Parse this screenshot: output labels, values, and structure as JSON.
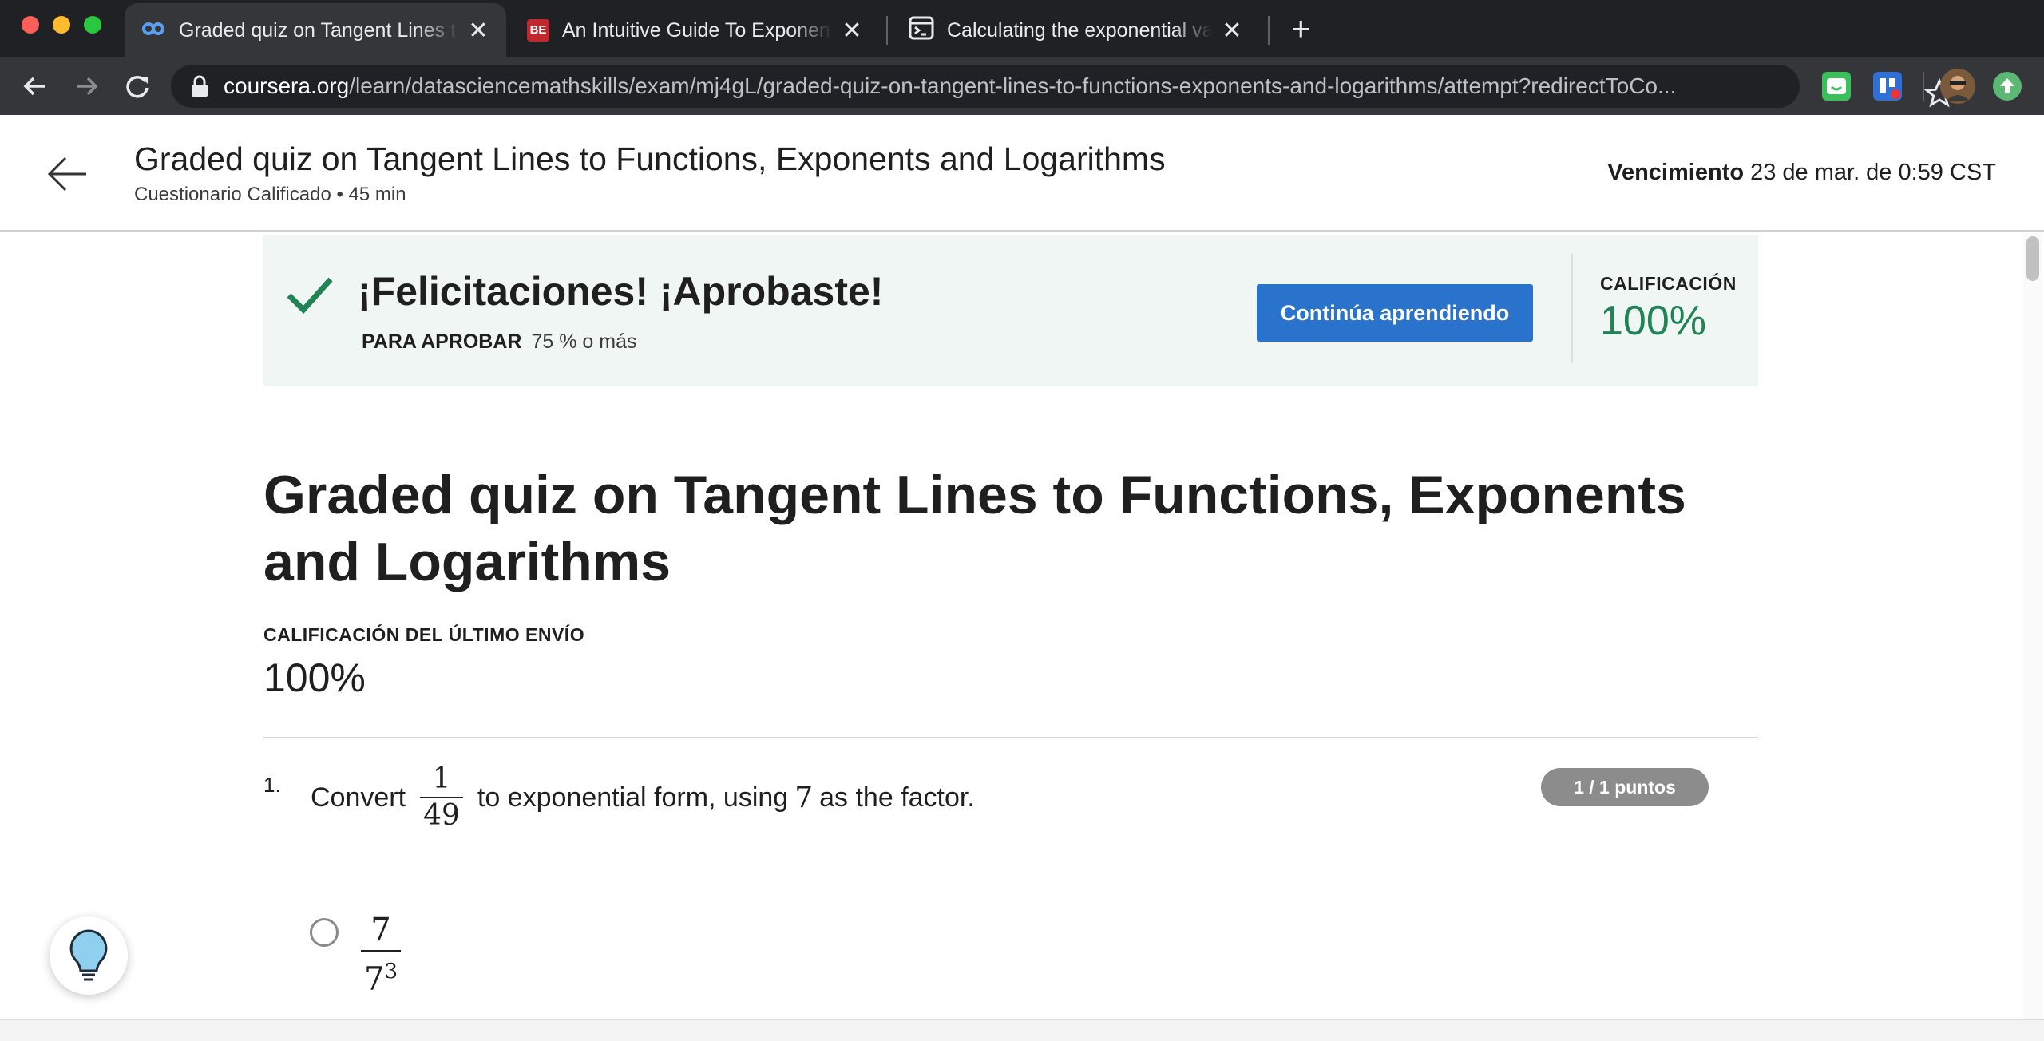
{
  "browser": {
    "tabs": [
      {
        "title": "Graded quiz on Tangent Lines to Functions, Exponents and Logarithms",
        "icon": "coursera-icon",
        "active": true
      },
      {
        "title": "An Intuitive Guide To Exponential Functions",
        "icon": "betterexplained-icon",
        "active": false
      },
      {
        "title": "Calculating the exponential value",
        "icon": "terminal-icon",
        "active": false
      }
    ],
    "url_host": "coursera.org",
    "url_path": "/learn/datasciencemathskills/exam/mj4gL/graded-quiz-on-tangent-lines-to-functions-exponents-and-logarithms/attempt?redirectToCo..."
  },
  "header": {
    "title": "Graded quiz on Tangent Lines to Functions, Exponents and Logarithms",
    "subtitle": "Cuestionario Calificado • 45 min",
    "due_label": "Vencimiento",
    "due_value": "23 de mar. de 0:59 CST"
  },
  "banner": {
    "message": "¡Felicitaciones! ¡Aprobaste!",
    "pass_label": "PARA APROBAR",
    "pass_value": "75 % o más",
    "continue_button": "Continúa aprendiendo",
    "grade_label": "CALIFICACIÓN",
    "grade_value": "100%",
    "accent_color": "#1f8354",
    "button_color": "#2a73cc"
  },
  "quiz": {
    "title": "Graded quiz on Tangent Lines to Functions, Exponents and Logarithms",
    "last_grade_label": "CALIFICACIÓN DEL ÚLTIMO ENVÍO",
    "last_grade_value": "100%",
    "questions": [
      {
        "number": "1.",
        "text_before": "Convert",
        "fraction_num": "1",
        "fraction_den": "49",
        "text_middle": "to exponential form, using",
        "factor": "7",
        "text_after": "as the factor.",
        "points": "1 / 1 puntos",
        "options": [
          {
            "num": "7",
            "den_base": "7",
            "den_exp": "3"
          }
        ]
      }
    ]
  }
}
